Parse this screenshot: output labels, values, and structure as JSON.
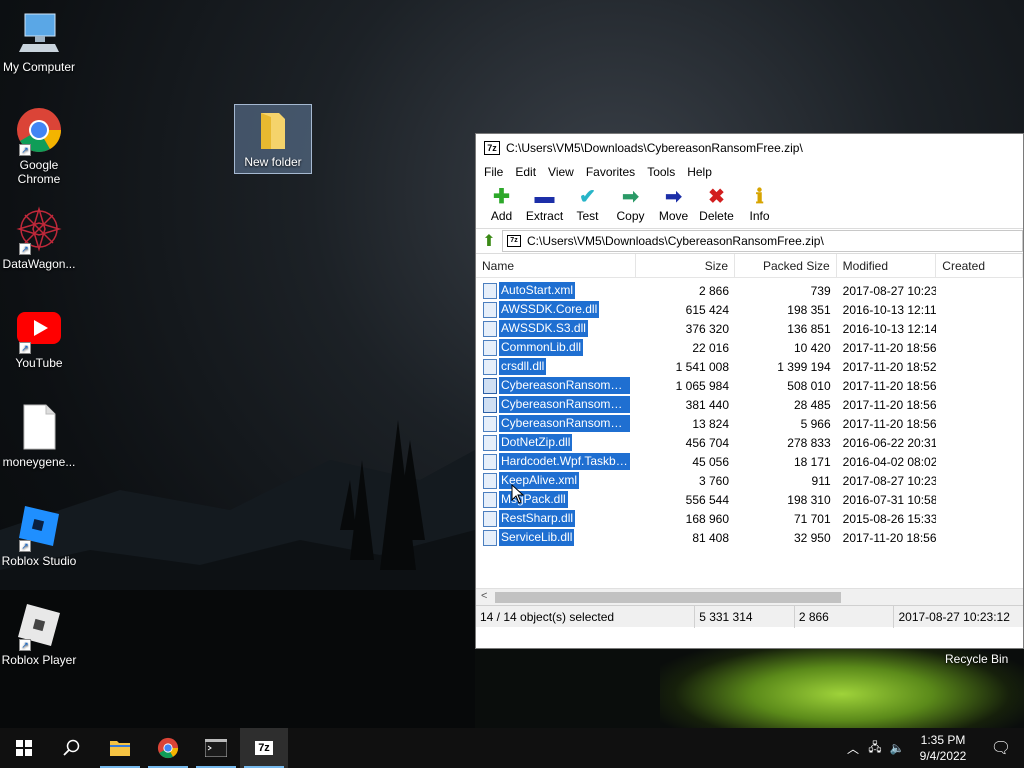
{
  "desktop": {
    "icons": [
      {
        "label": "My Computer"
      },
      {
        "label": "Google Chrome"
      },
      {
        "label": "DataWagon..."
      },
      {
        "label": "YouTube"
      },
      {
        "label": "moneygene..."
      },
      {
        "label": "Roblox Studio"
      },
      {
        "label": "Roblox Player"
      },
      {
        "label": "New folder"
      }
    ],
    "recycle_bin": "Recycle Bin"
  },
  "window": {
    "title": "C:\\Users\\VM5\\Downloads\\CybereasonRansomFree.zip\\",
    "menu": [
      "File",
      "Edit",
      "View",
      "Favorites",
      "Tools",
      "Help"
    ],
    "toolbar": [
      {
        "label": "Add",
        "icon": "plus-icon",
        "color": "#2da82a"
      },
      {
        "label": "Extract",
        "icon": "minus-icon",
        "color": "#1c2fa8"
      },
      {
        "label": "Test",
        "icon": "check-icon",
        "color": "#28b5c8"
      },
      {
        "label": "Copy",
        "icon": "copy-arrow-icon",
        "color": "#2b9a67"
      },
      {
        "label": "Move",
        "icon": "move-arrow-icon",
        "color": "#1c2fa8"
      },
      {
        "label": "Delete",
        "icon": "delete-icon",
        "color": "#d21e1e"
      },
      {
        "label": "Info",
        "icon": "info-icon",
        "color": "#d7a400"
      }
    ],
    "address": "C:\\Users\\VM5\\Downloads\\CybereasonRansomFree.zip\\",
    "columns": {
      "name": "Name",
      "size": "Size",
      "packed": "Packed Size",
      "modified": "Modified",
      "created": "Created"
    },
    "files": [
      {
        "name": "AutoStart.xml",
        "size": "2 866",
        "packed": "739",
        "modified": "2017-08-27 10:23",
        "type": "doc"
      },
      {
        "name": "AWSSDK.Core.dll",
        "size": "615 424",
        "packed": "198 351",
        "modified": "2016-10-13 12:11",
        "type": "doc"
      },
      {
        "name": "AWSSDK.S3.dll",
        "size": "376 320",
        "packed": "136 851",
        "modified": "2016-10-13 12:14",
        "type": "doc"
      },
      {
        "name": "CommonLib.dll",
        "size": "22 016",
        "packed": "10 420",
        "modified": "2017-11-20 18:56",
        "type": "doc"
      },
      {
        "name": "crsdll.dll",
        "size": "1 541 008",
        "packed": "1 399 194",
        "modified": "2017-11-20 18:52",
        "type": "doc"
      },
      {
        "name": "CybereasonRansomFree...",
        "size": "1 065 984",
        "packed": "508 010",
        "modified": "2017-11-20 18:56",
        "type": "exe"
      },
      {
        "name": "CybereasonRansomFree...",
        "size": "381 440",
        "packed": "28 485",
        "modified": "2017-11-20 18:56",
        "type": "exe"
      },
      {
        "name": "CybereasonRansomFree...",
        "size": "13 824",
        "packed": "5 966",
        "modified": "2017-11-20 18:56",
        "type": "doc"
      },
      {
        "name": "DotNetZip.dll",
        "size": "456 704",
        "packed": "278 833",
        "modified": "2016-06-22 20:31",
        "type": "doc"
      },
      {
        "name": "Hardcodet.Wpf.Taskbar...",
        "size": "45 056",
        "packed": "18 171",
        "modified": "2016-04-02 08:02",
        "type": "doc"
      },
      {
        "name": "KeepAlive.xml",
        "size": "3 760",
        "packed": "911",
        "modified": "2017-08-27 10:23",
        "type": "doc"
      },
      {
        "name": "MsgPack.dll",
        "size": "556 544",
        "packed": "198 310",
        "modified": "2016-07-31 10:58",
        "type": "doc"
      },
      {
        "name": "RestSharp.dll",
        "size": "168 960",
        "packed": "71 701",
        "modified": "2015-08-26 15:33",
        "type": "doc"
      },
      {
        "name": "ServiceLib.dll",
        "size": "81 408",
        "packed": "32 950",
        "modified": "2017-11-20 18:56",
        "type": "doc"
      }
    ],
    "status": {
      "selection": "14 / 14 object(s) selected",
      "total_size": "5 331 314",
      "item_size": "2 866",
      "item_date": "2017-08-27 10:23:12"
    }
  },
  "taskbar": {
    "time": "1:35 PM",
    "date": "9/4/2022"
  }
}
